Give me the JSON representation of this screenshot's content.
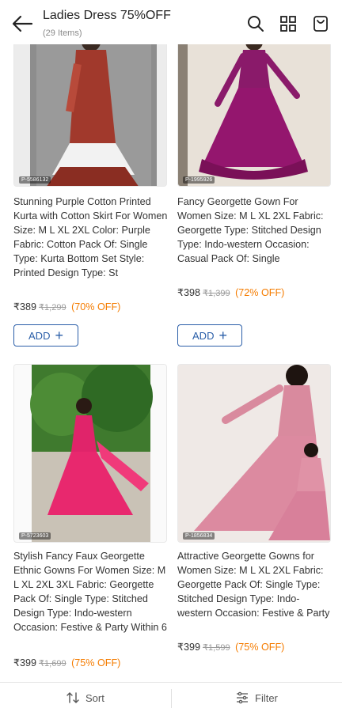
{
  "header": {
    "title": "Ladies Dress 75%OFF",
    "subtitle": "(29 Items)",
    "icons": [
      "back-arrow-icon",
      "search-icon",
      "grid-view-icon",
      "cart-icon"
    ]
  },
  "products": [
    {
      "title": "Stunning Purple Cotton Printed Kurta with Cotton Skirt For Women Size: M L XL 2XL Color: Purple Fabric: Cotton Pack Of: Single Type: Kurta Bottom Set Style: Printed Design Type: St",
      "price": "₹389",
      "mrp": "₹1,299",
      "off": "(70% OFF)",
      "add": "ADD",
      "pid": "P-5586132"
    },
    {
      "title": "Fancy Georgette Gown For Women Size: M L XL 2XL Fabric: Georgette Type: Stitched Design Type: Indo-western Occasion: Casual Pack Of: Single",
      "price": "₹398",
      "mrp": "₹1,399",
      "off": "(72% OFF)",
      "add": "ADD",
      "pid": "P-1995926"
    },
    {
      "title": "Stylish Fancy Faux Georgette Ethnic Gowns For Women Size: M L XL 2XL 3XL Fabric: Georgette Pack Of: Single Type: Stitched Design Type: Indo-western Occasion: Festive & Party Within 6",
      "price": "₹399",
      "mrp": "₹1,699",
      "off": "(75% OFF)",
      "pid": "P-5723603"
    },
    {
      "title": "Attractive Georgette Gowns for Women Size: M L XL 2XL Fabric: Georgette Pack Of: Single Type: Stitched Design Type: Indo-western Occasion: Festive & Party",
      "price": "₹399",
      "mrp": "₹1,599",
      "off": "(75% OFF)",
      "pid": "P-1856834"
    }
  ],
  "bottom_bar": {
    "sort": "Sort",
    "filter": "Filter"
  },
  "colors": {
    "accent": "#2a5ea8",
    "discount": "#f57c00"
  }
}
